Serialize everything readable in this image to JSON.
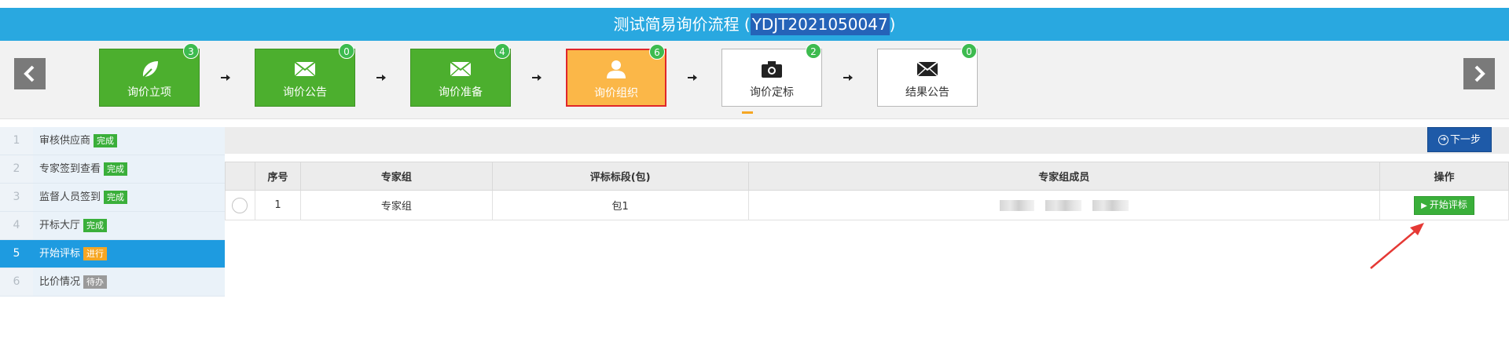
{
  "header": {
    "title_prefix": "测试简易询价流程 (",
    "project_code": "YDJT2021050047",
    "title_suffix": ")"
  },
  "steps": [
    {
      "label": "询价立项",
      "count": "3",
      "state": "complete",
      "icon": "leaf-icon"
    },
    {
      "label": "询价公告",
      "count": "0",
      "state": "complete",
      "icon": "envelope-icon"
    },
    {
      "label": "询价准备",
      "count": "4",
      "state": "complete",
      "icon": "envelope-icon"
    },
    {
      "label": "询价组织",
      "count": "6",
      "state": "current",
      "icon": "user-icon"
    },
    {
      "label": "询价定标",
      "count": "2",
      "state": "pending",
      "icon": "camera-icon"
    },
    {
      "label": "结果公告",
      "count": "0",
      "state": "pending",
      "icon": "envelope-icon"
    }
  ],
  "sidebar": {
    "items": [
      {
        "num": "1",
        "label": "审核供应商",
        "status": "完成"
      },
      {
        "num": "2",
        "label": "专家签到查看",
        "status": "完成"
      },
      {
        "num": "3",
        "label": "监督人员签到",
        "status": "完成"
      },
      {
        "num": "4",
        "label": "开标大厅",
        "status": "完成"
      },
      {
        "num": "5",
        "label": "开始评标",
        "status": "进行"
      },
      {
        "num": "6",
        "label": "比价情况",
        "status": "待办"
      }
    ]
  },
  "toolbar": {
    "next_label": "下一步"
  },
  "table": {
    "headers": [
      "序号",
      "专家组",
      "评标标段(包)",
      "专家组成员",
      "操作"
    ],
    "rows": [
      {
        "index": "1",
        "group": "专家组",
        "section": "包1",
        "action": "开始评标"
      }
    ]
  },
  "colors": {
    "title_bar": "#29a8e0",
    "step_complete": "#4caf2e",
    "step_current": "#fbb748",
    "badge": "#3dbb4f",
    "sidebar_active": "#1e9be0",
    "next_button": "#1e5aa8",
    "action_button": "#3aaf3a",
    "annotation_arrow": "#e53935"
  }
}
